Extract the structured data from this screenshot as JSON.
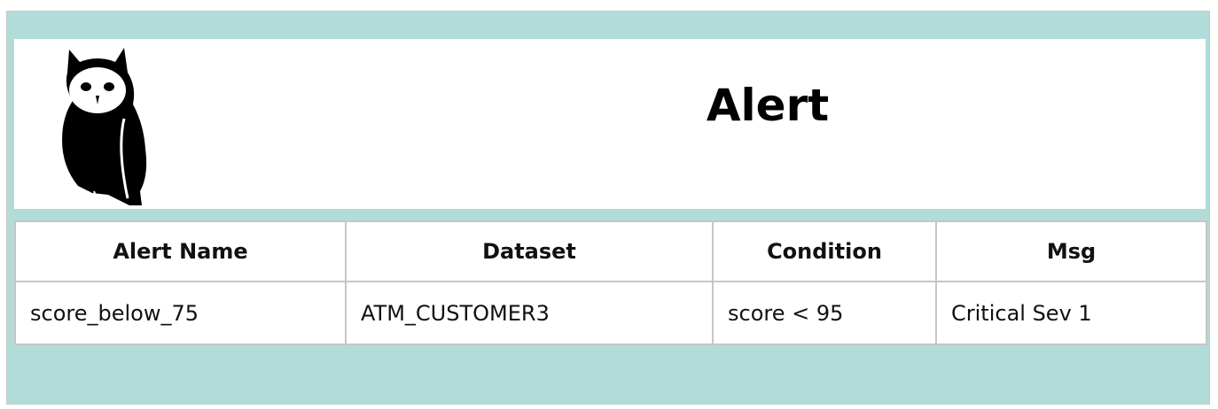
{
  "header": {
    "title": "Alert",
    "logo_icon": "owl-icon"
  },
  "colors": {
    "frame_background": "#b2dcd9",
    "panel_background": "#ffffff",
    "border": "#c6c6c6"
  },
  "table": {
    "columns": [
      "Alert Name",
      "Dataset",
      "Condition",
      "Msg"
    ],
    "rows": [
      {
        "alert_name": "score_below_75",
        "dataset": "ATM_CUSTOMER3",
        "condition": "score < 95",
        "msg": "Critical Sev 1"
      }
    ]
  }
}
